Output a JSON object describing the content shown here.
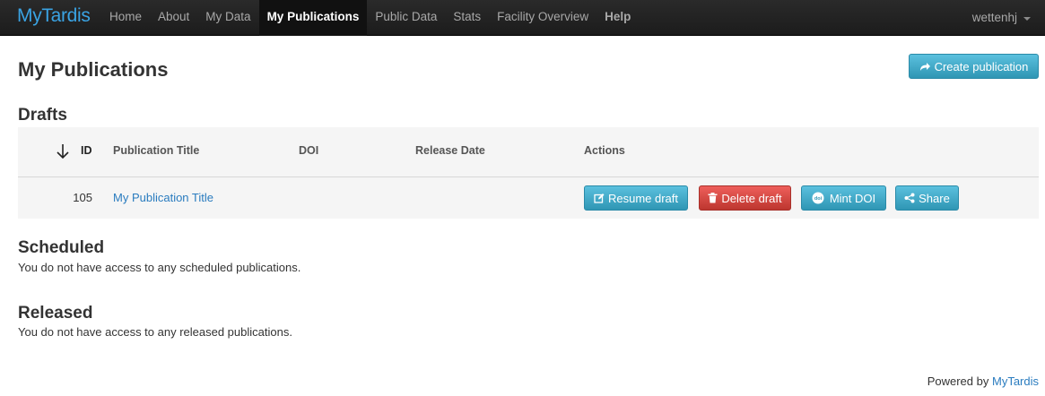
{
  "navbar": {
    "brand": "MyTardis",
    "items": [
      {
        "label": "Home"
      },
      {
        "label": "About"
      },
      {
        "label": "My Data"
      },
      {
        "label": "My Publications"
      },
      {
        "label": "Public Data"
      },
      {
        "label": "Stats"
      },
      {
        "label": "Facility Overview"
      },
      {
        "label": "Help"
      }
    ],
    "active": "My Publications",
    "user": "wettenhj"
  },
  "page": {
    "title": "My Publications",
    "create_button": "Create publication"
  },
  "drafts": {
    "heading": "Drafts",
    "columns": [
      "ID",
      "Publication Title",
      "DOI",
      "Release Date",
      "Actions"
    ],
    "rows": [
      {
        "id": "105",
        "title": "My Publication Title",
        "doi": "",
        "release_date": "",
        "actions": {
          "resume": "Resume draft",
          "delete": "Delete draft",
          "mint": "Mint DOI",
          "share": "Share"
        }
      }
    ]
  },
  "scheduled": {
    "heading": "Scheduled",
    "message": "You do not have access to any scheduled publications."
  },
  "released": {
    "heading": "Released",
    "message": "You do not have access to any released publications."
  },
  "footer": {
    "prefix": "Powered by",
    "link": "MyTardis"
  },
  "colors": {
    "brand": "#3aa3e3",
    "info_button": "#49afcd",
    "danger_button": "#da4f49",
    "link": "#2a7cbf"
  }
}
